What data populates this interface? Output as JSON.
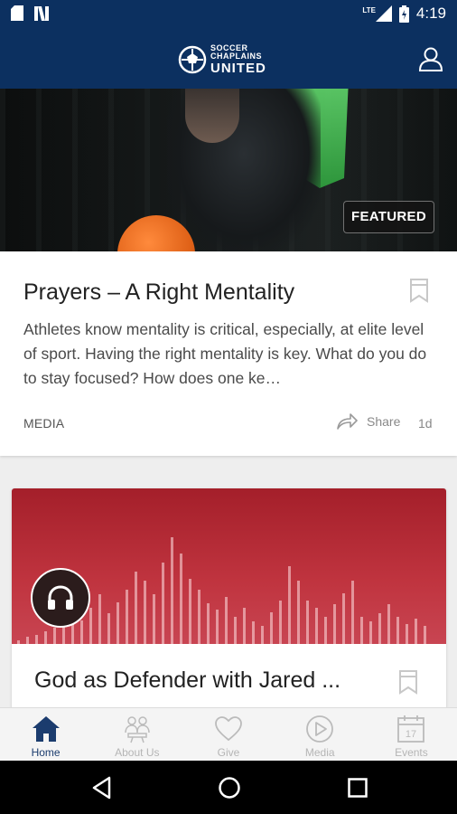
{
  "status_bar": {
    "time": "4:19",
    "network": "LTE"
  },
  "app_bar": {
    "logo_line1": "SOCCER",
    "logo_line2": "CHAPLAINS",
    "logo_line3": "UNITED"
  },
  "featured_card": {
    "badge": "FEATURED",
    "title": "Prayers – A Right Mentality",
    "description": "Athletes know mentality is critical, especially, at elite level of sport. Having the right mentality is key. What do you do to stay focused? How does one ke…",
    "category": "MEDIA",
    "share_label": "Share",
    "age": "1d"
  },
  "second_card": {
    "title": "God as Defender with Jared ..."
  },
  "bottom_nav": {
    "items": [
      {
        "label": "Home",
        "icon": "home-icon",
        "active": true
      },
      {
        "label": "About Us",
        "icon": "people-icon",
        "active": false
      },
      {
        "label": "Give",
        "icon": "heart-icon",
        "active": false
      },
      {
        "label": "Media",
        "icon": "play-icon",
        "active": false
      },
      {
        "label": "Events",
        "icon": "calendar-icon",
        "active": false
      }
    ]
  },
  "calendar_day": "17",
  "colors": {
    "primary": "#0c3060",
    "accent_red": "#b32a35",
    "active_nav": "#1b3c6e"
  }
}
